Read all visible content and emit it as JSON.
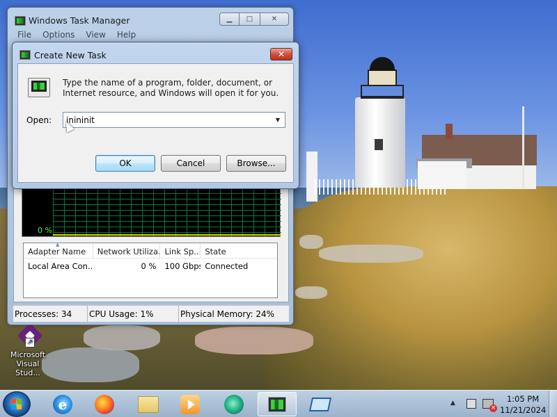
{
  "desktop": {
    "icons": [
      {
        "label": "Microsoft Visual Stud...",
        "icon": "visual-studio-icon"
      }
    ]
  },
  "task_manager": {
    "title": "Windows Task Manager",
    "menu": [
      "File",
      "Options",
      "View",
      "Help"
    ],
    "caption_buttons": {
      "minimize": "▁",
      "maximize": "□",
      "close": "✕"
    },
    "graph": {
      "percent_label": "0 %",
      "utilization_pct": 0
    },
    "network_table": {
      "headers": [
        "Adapter Name",
        "Network Utiliza...",
        "Link Sp...",
        "State"
      ],
      "rows": [
        [
          "Local Area Con...",
          "0 %",
          "100 Gbps",
          "Connected"
        ]
      ]
    },
    "status_bar": {
      "processes": "Processes: 34",
      "cpu": "CPU Usage: 1%",
      "memory": "Physical Memory: 24%"
    }
  },
  "dialog": {
    "title": "Create New Task",
    "close_glyph": "✕",
    "message": "Type the name of a program, folder, document, or Internet resource, and Windows will open it for you.",
    "open_label": "Open:",
    "open_value": "inininit",
    "combo_arrow": "▼",
    "buttons": {
      "ok": "OK",
      "cancel": "Cancel",
      "browse": "Browse..."
    }
  },
  "taskbar": {
    "pinned": [
      {
        "name": "internet-explorer",
        "glyph": "e"
      },
      {
        "name": "firefox"
      },
      {
        "name": "file-explorer"
      },
      {
        "name": "media-player"
      },
      {
        "name": "globe-app"
      },
      {
        "name": "task-manager",
        "active": true
      },
      {
        "name": "create-new-task"
      }
    ],
    "tray": {
      "up_arrow": "▲"
    },
    "clock": {
      "time": "1:05 PM",
      "date": "11/21/2024"
    }
  },
  "colors": {
    "title_bar": "#bcd1e8",
    "close_button": "#d0503a",
    "graph_background": "#000000",
    "graph_grid": "#0b7a3c",
    "graph_text": "#3cff3c"
  }
}
